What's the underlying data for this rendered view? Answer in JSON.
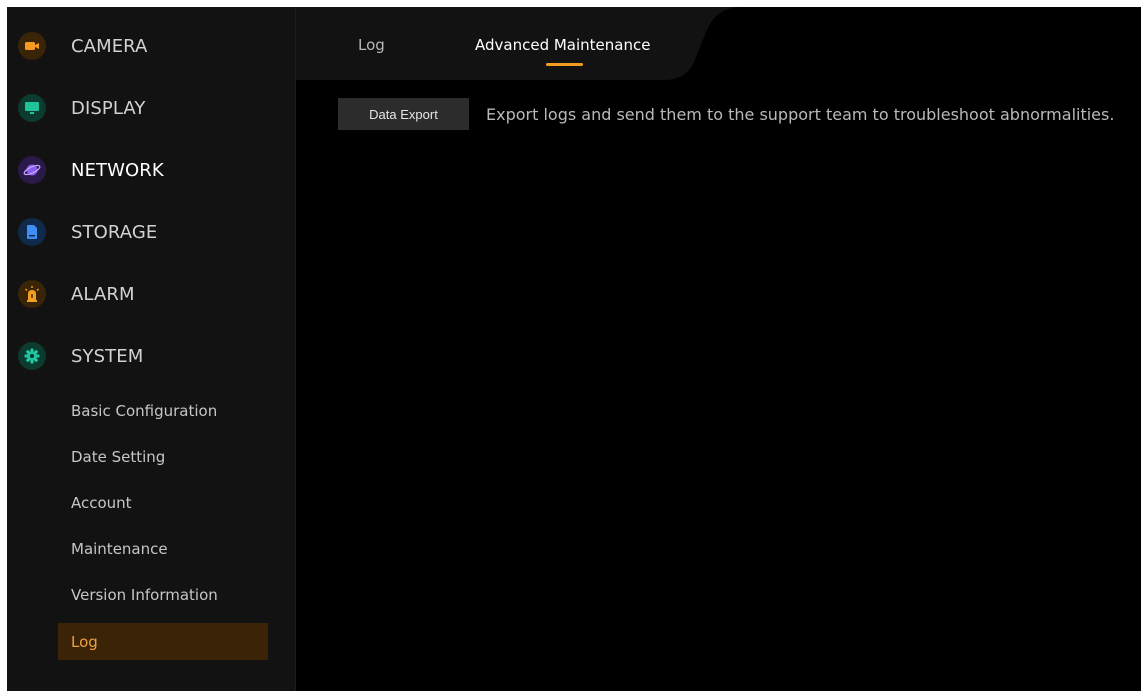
{
  "sidebar": {
    "categories": [
      {
        "label": "CAMERA",
        "icon": "camera-icon",
        "color": "#f39a22"
      },
      {
        "label": "DISPLAY",
        "icon": "monitor-icon",
        "color": "#1fc49a"
      },
      {
        "label": "NETWORK",
        "icon": "globe-icon",
        "color": "#8e5cf0"
      },
      {
        "label": "STORAGE",
        "icon": "storage-icon",
        "color": "#3f8ef5"
      },
      {
        "label": "ALARM",
        "icon": "alarm-icon",
        "color": "#f3a020"
      },
      {
        "label": "SYSTEM",
        "icon": "gear-icon",
        "color": "#20c9a0"
      }
    ],
    "active_category": "NETWORK",
    "system_items": [
      {
        "label": "Basic Configuration"
      },
      {
        "label": "Date Setting"
      },
      {
        "label": "Account"
      },
      {
        "label": "Maintenance"
      },
      {
        "label": "Version Information"
      },
      {
        "label": "Log"
      }
    ],
    "selected_item": "Log"
  },
  "tabs": [
    {
      "label": "Log"
    },
    {
      "label": "Advanced Maintenance"
    }
  ],
  "active_tab": "Advanced Maintenance",
  "content": {
    "export_button": "Data Export",
    "export_description": "Export logs and send them to the support team to troubleshoot abnormalities."
  },
  "colors": {
    "accent": "#f39a22",
    "background": "#000000",
    "sidebar": "#121212",
    "selected_item_bg": "#3b2308"
  }
}
